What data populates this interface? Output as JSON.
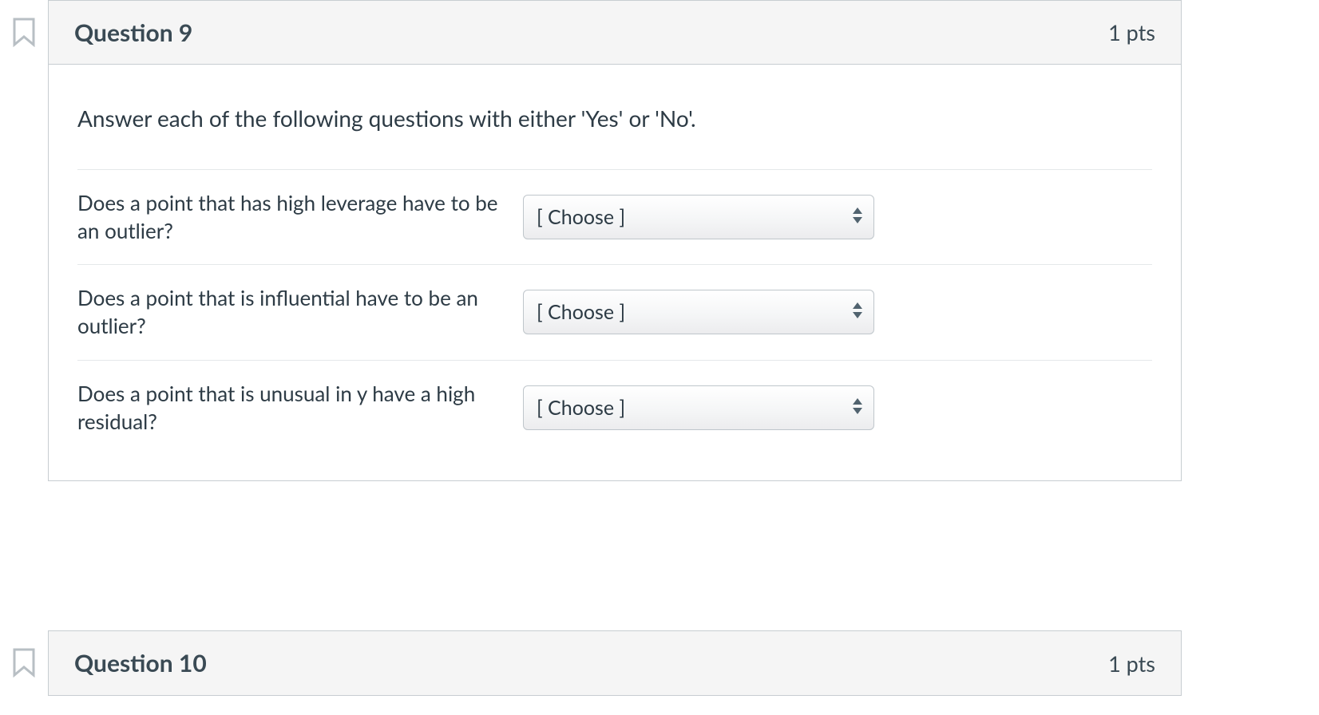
{
  "questions": [
    {
      "title": "Question 9",
      "points": "1 pts",
      "prompt": "Answer each of the following questions with either 'Yes' or 'No'.",
      "rows": [
        {
          "label": "Does a point that has high leverage have to be an outlier?",
          "selected": "[ Choose ]"
        },
        {
          "label": "Does a point that is influential have to be an outlier?",
          "selected": "[ Choose ]"
        },
        {
          "label": "Does a point that is unusual in y have a high residual?",
          "selected": "[ Choose ]"
        }
      ]
    },
    {
      "title": "Question 10",
      "points": "1 pts"
    }
  ]
}
